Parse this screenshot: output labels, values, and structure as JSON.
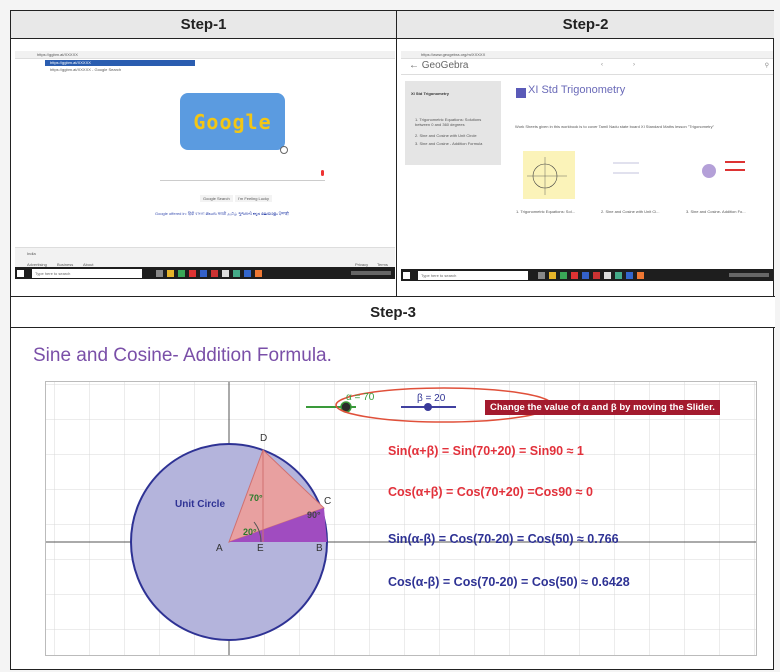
{
  "headers": {
    "step1": "Step-1",
    "step2": "Step-2",
    "step3": "Step-3"
  },
  "step1": {
    "url": "https://ggbm.at/XXXXX",
    "suggestion": "https://ggbm.at/XXXXX",
    "suggestion2": "https://ggbm.at/XXXXX - Google Search",
    "logo": "Google",
    "search_button": "Google Search",
    "lucky_button": "I'm Feeling Lucky",
    "offered_in": "Google offered in: हिंदी বাংলা తెలుగు मराठी தமிழ் ગુજરાતી ಕನ್ನಡ മലയാളം ਪੰਜਾਬੀ",
    "country": "India",
    "footer_left": [
      "Advertising",
      "Business",
      "About"
    ],
    "footer_right": [
      "Privacy",
      "Terms"
    ],
    "taskbar_search": "Type here to search"
  },
  "step2": {
    "url": "https://www.geogebra.org/m/XXXXX",
    "brand": "← GeoGebra",
    "sidebar_title": "XI Std Trigonometry",
    "sidebar_items": [
      "1. Trigonometric Equations: Solutions between 0 and 360 degrees",
      "2. Sine and Cosine with Unit Circle",
      "3. Sine and Cosine - Addition Formula"
    ],
    "book_title": "XI Std Trigonometry",
    "description": "Work Sheets given in this workbook is to cover Tamil Nadu state board XI Standard Maths lesson \"Trigonometry\"",
    "thumbs": [
      "1. Trigonometric Equations: Sol...",
      "2. Sine and Cosine with Unit Ci...",
      "3. Sine and Cosine- Addition Fo..."
    ],
    "taskbar_search": "Type here to search"
  },
  "step3": {
    "title": "Sine and Cosine- Addition Formula.",
    "alpha_label": "α = 70",
    "beta_label": "β = 20",
    "instruction": "Change the value of  α  and  β by moving the Slider.",
    "unit_circle_label": "Unit Circle",
    "points": {
      "A": "A",
      "B": "B",
      "C": "C",
      "D": "D",
      "E": "E"
    },
    "angle_labels": [
      "70°",
      "20°",
      "90°"
    ],
    "formulas": [
      "Sin(α+β)  =  Sin(70+20) = Sin90 ≈  1",
      "Cos(α+β) = Cos(70+20) =Cos90 ≈  0",
      "Sin(α-β) = Cos(70-20) = Cos(50) ≈ 0.766",
      "Cos(α-β) = Cos(70-20) = Cos(50) ≈ 0.6428"
    ],
    "colors": {
      "red": "#e2313b",
      "navy": "#2e3294",
      "purple_title": "#7a4fa8",
      "circle_fill": "#b4b4dc",
      "sector_red": "#e8a0a0",
      "sector_purple": "#a04cc0",
      "instruction_bg": "#a31a2e"
    }
  }
}
